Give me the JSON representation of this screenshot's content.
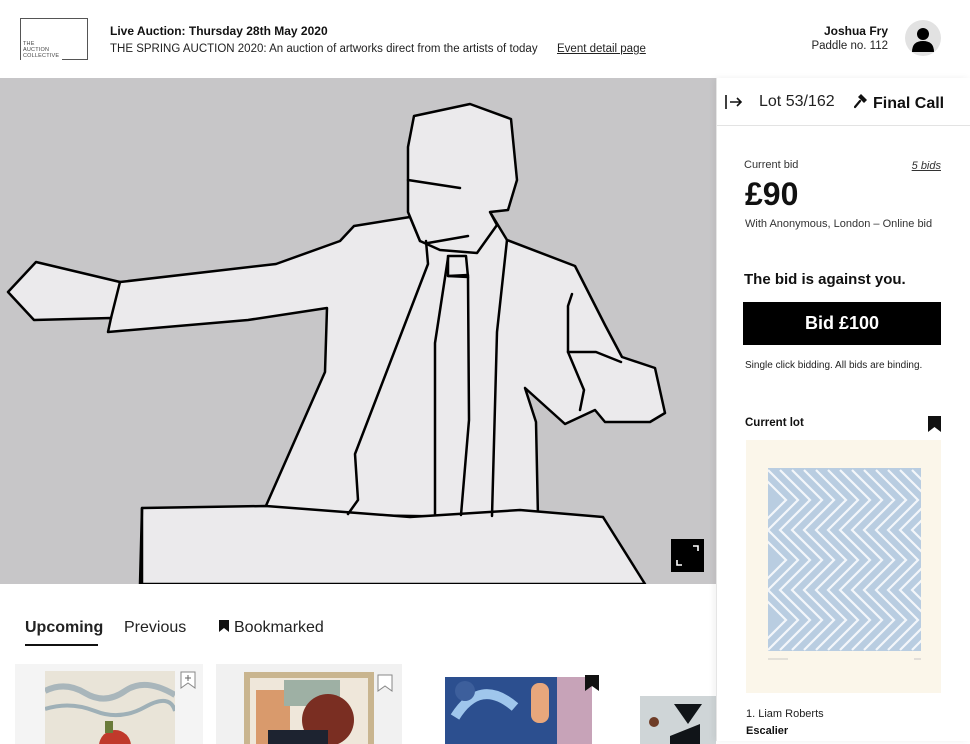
{
  "header": {
    "logo_text": "THE\nAUCTION\nCOLLECTIVE",
    "auction_title": "Live Auction: Thursday 28th May 2020",
    "auction_subtitle": "THE SPRING AUCTION 2020: An auction of artworks direct from the artists of today",
    "event_link": "Event detail page",
    "user_name": "Joshua Fry",
    "paddle": "Paddle no. 112"
  },
  "tabs": [
    {
      "label": "Upcoming",
      "active": true
    },
    {
      "label": "Previous",
      "active": false
    },
    {
      "label": "Bookmarked",
      "active": false,
      "icon": "bookmark-icon"
    }
  ],
  "panel": {
    "lot_counter": "Lot 53/162",
    "final_call": "Final Call",
    "current_bid_label": "Current bid",
    "bids_count": "5 bids",
    "bid_amount": "£90",
    "bid_with": "With Anonymous, London – Online bid",
    "against_text": "The bid is against you.",
    "bid_button": "Bid £100",
    "binding_note": "Single click bidding. All bids are binding.",
    "current_lot_label": "Current lot",
    "lot_artist": "1. Liam Roberts",
    "lot_title": "Escalier"
  },
  "colors": {
    "stage_bg": "#c7c6c8",
    "figure_fill": "#ebeaec",
    "accent": "#000000"
  }
}
